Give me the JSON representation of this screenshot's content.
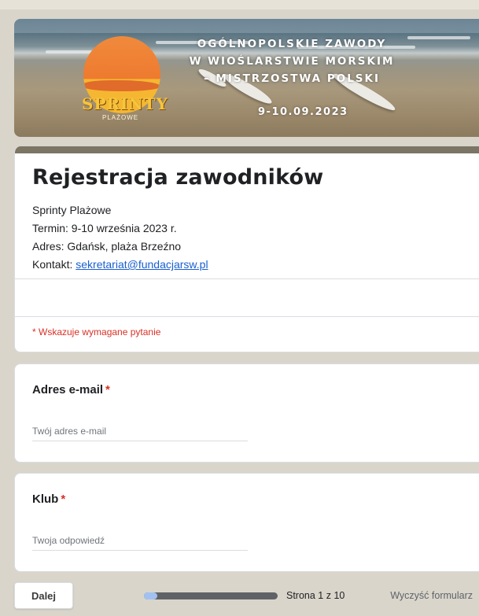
{
  "banner": {
    "title_lines": [
      "OGÓLNOPOLSKIE ZAWODY",
      "W WIOŚLARSTWIE MORSKIM",
      "– MISTRZOSTWA POLSKI"
    ],
    "date": "9-10.09.2023",
    "logo_main": "SPRINTY",
    "logo_sub": "PLAŻOWE"
  },
  "form": {
    "title": "Rejestracja zawodników",
    "description": {
      "line1": "Sprinty Plażowe",
      "line2": "Termin: 9-10 września 2023 r.",
      "line3": "Adres: Gdańsk, plaża Brzeźno",
      "contact_label": "Kontakt: ",
      "contact_email": "sekretariat@fundacjarsw.pl"
    },
    "required_note": "* Wskazuje wymagane pytanie"
  },
  "questions": [
    {
      "label": "Adres e-mail",
      "required_mark": "*",
      "placeholder": "Twój adres e-mail",
      "value": ""
    },
    {
      "label": "Klub",
      "required_mark": "*",
      "placeholder": "Twoja odpowiedź",
      "value": ""
    }
  ],
  "footer": {
    "next_label": "Dalej",
    "page_info": "Strona 1 z 10",
    "progress_fraction": 0.1,
    "clear_label": "Wyczyść formularz"
  },
  "colors": {
    "accent": "#7b7565",
    "required": "#d93025",
    "link": "#1a5fd0",
    "progress_fill": "#a1c2f0",
    "progress_track": "#5f6368"
  }
}
